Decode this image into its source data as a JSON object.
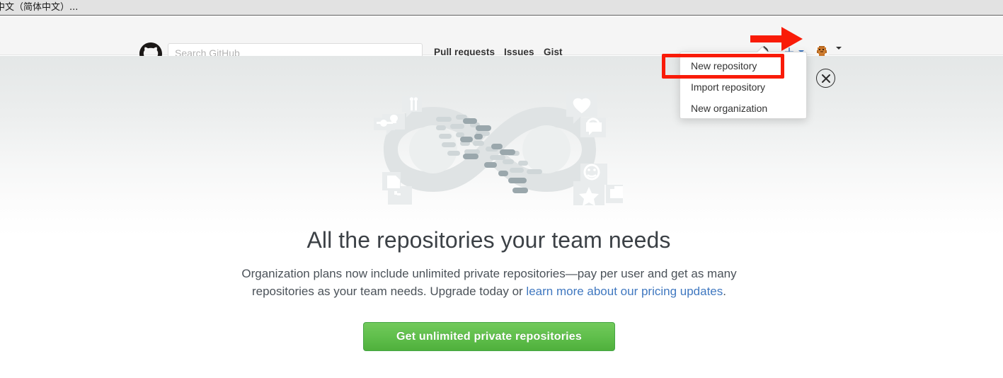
{
  "browser": {
    "tab_title": "中文（简体中文）..."
  },
  "header": {
    "logo_icon": "octocat-logo-icon",
    "search": {
      "placeholder": "Search GitHub",
      "value": ""
    },
    "nav": [
      {
        "label": "Pull requests"
      },
      {
        "label": "Issues"
      },
      {
        "label": "Gist"
      }
    ],
    "notifications_icon": "bell-icon",
    "create_new": {
      "icon": "plus-icon",
      "symbol": "+",
      "accent_color": "#4078c0"
    },
    "account": {
      "avatar_icon": "avatar-icon",
      "caret_icon": "chevron-down-icon"
    }
  },
  "create_new_menu": {
    "items": [
      {
        "label": "New repository",
        "highlighted": true
      },
      {
        "label": "Import repository",
        "highlighted": false
      },
      {
        "label": "New organization",
        "highlighted": false
      }
    ],
    "highlight_color": "#f91b08"
  },
  "annotations": {
    "arrow": {
      "name": "red-arrow-annotation",
      "color": "#f91b08",
      "points_to": "plus-icon"
    },
    "highlight_box": {
      "name": "red-highlight-box",
      "color": "#f91b08",
      "surrounds": "New repository"
    }
  },
  "banner": {
    "close_label": "×",
    "illustration_icon": "infinity-loop-illustration",
    "title": "All the repositories your team needs",
    "description_part1": "Organization plans now include unlimited private repositories—pay per user and get as many repositories as your team needs. Upgrade today or ",
    "description_link": "learn more about our pricing updates",
    "description_part2": ".",
    "cta_label": "Get unlimited private repositories",
    "cta_color": "#60bf4c",
    "link_color": "#4078c0"
  }
}
